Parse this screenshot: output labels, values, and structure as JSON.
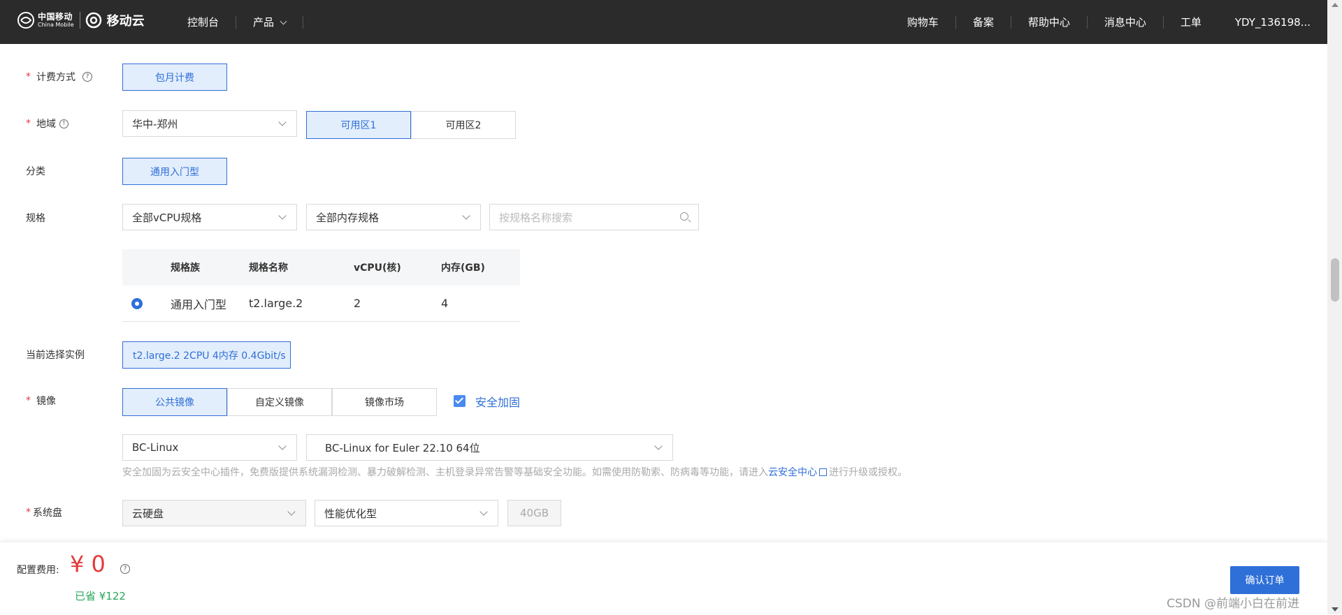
{
  "header": {
    "logo_cn": "中国移动",
    "logo_en": "China Mobile",
    "logo_cloud": "移动云",
    "nav_left": [
      {
        "label": "控制台"
      },
      {
        "label": "产品"
      }
    ],
    "nav_right": [
      {
        "label": "购物车"
      },
      {
        "label": "备案"
      },
      {
        "label": "帮助中心"
      },
      {
        "label": "消息中心"
      },
      {
        "label": "工单"
      }
    ],
    "user": "YDY_136198..."
  },
  "form": {
    "billing": {
      "label": "计费方式",
      "option": "包月计费"
    },
    "region": {
      "label": "地域",
      "value": "华中-郑州",
      "zones": [
        "可用区1",
        "可用区2"
      ]
    },
    "category": {
      "label": "分类",
      "option": "通用入门型"
    },
    "spec": {
      "label": "规格",
      "vcpu_select": "全部vCPU规格",
      "memory_select": "全部内存规格",
      "search_placeholder": "按规格名称搜索",
      "table": {
        "headers": [
          "规格族",
          "规格名称",
          "vCPU(核)",
          "内存(GB)"
        ],
        "rows": [
          [
            "通用入门型",
            "t2.large.2",
            "2",
            "4"
          ]
        ]
      }
    },
    "current_instance": {
      "label": "当前选择实例",
      "value": "t2.large.2 2CPU 4内存 0.4Gbit/s"
    },
    "image": {
      "label": "镜像",
      "tabs": [
        "公共镜像",
        "自定义镜像",
        "镜像市场"
      ],
      "security_label": "安全加固",
      "os_select": "BC-Linux",
      "version_select": "BC-Linux for Euler 22.10 64位",
      "hint_prefix": "安全加固为云安全中心插件，免费版提供系统漏洞检测、暴力破解检测、主机登录异常告警等基础安全功能。如需使用防勒索、防病毒等功能，请进入",
      "hint_link": "云安全中心",
      "hint_suffix": "进行升级或授权。"
    },
    "system_disk": {
      "label": "系统盘",
      "type": "云硬盘",
      "perf": "性能优化型",
      "size": "40GB"
    }
  },
  "footer": {
    "fee_label": "配置费用:",
    "fee_value": "¥ 0",
    "saved": "已省 ¥122",
    "confirm": "确认订单",
    "watermark": "CSDN @前端小白在前进"
  },
  "colors": {
    "accent": "#2f6fd8",
    "price": "#e23b3b",
    "saved": "#29a55b",
    "topbar": "#2b2b2b"
  }
}
